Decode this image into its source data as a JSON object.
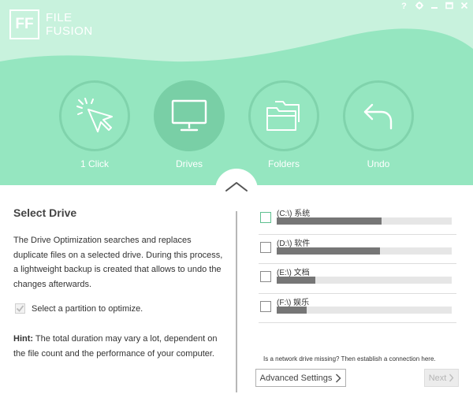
{
  "app": {
    "logo_mark": "FF",
    "logo_line1": "FILE",
    "logo_line2": "FUSION"
  },
  "window_controls": {
    "help": "?",
    "settings_icon": "gear-icon",
    "minimize_icon": "minimize-icon",
    "maximize_icon": "maximize-icon",
    "close_icon": "close-icon"
  },
  "colors": {
    "header_bg": "#95e6c0",
    "header_wave": "#c8f2dd",
    "active_circle": "#79cfa6",
    "circle_border": "#80d3ac"
  },
  "modes": [
    {
      "label": "1 Click",
      "icon": "click-cursor-icon",
      "active": false
    },
    {
      "label": "Drives",
      "icon": "monitor-icon",
      "active": true
    },
    {
      "label": "Folders",
      "icon": "folders-icon",
      "active": false
    },
    {
      "label": "Undo",
      "icon": "undo-arrow-icon",
      "active": false
    }
  ],
  "left": {
    "title": "Select Drive",
    "description": "The Drive Optimization searches and replaces duplicate files on a selected drive. During this process, a lightweight backup is created that allows to undo the changes afterwards.",
    "partition_label": "Select a partition to optimize.",
    "hint_label": "Hint:",
    "hint_text": " The total duration may vary a lot, dependent on the file count and the performance of your computer."
  },
  "drives": [
    {
      "name": "(C:\\) 系统",
      "usage": 0.6
    },
    {
      "name": "(D:\\) 软件",
      "usage": 0.59
    },
    {
      "name": "(E:\\) 文档",
      "usage": 0.22
    },
    {
      "name": "(F:\\) 娱乐",
      "usage": 0.17
    }
  ],
  "footer": {
    "network_text": "Is a network drive missing? Then establish a connection here.",
    "advanced_label": "Advanced Settings",
    "next_label": "Next"
  }
}
